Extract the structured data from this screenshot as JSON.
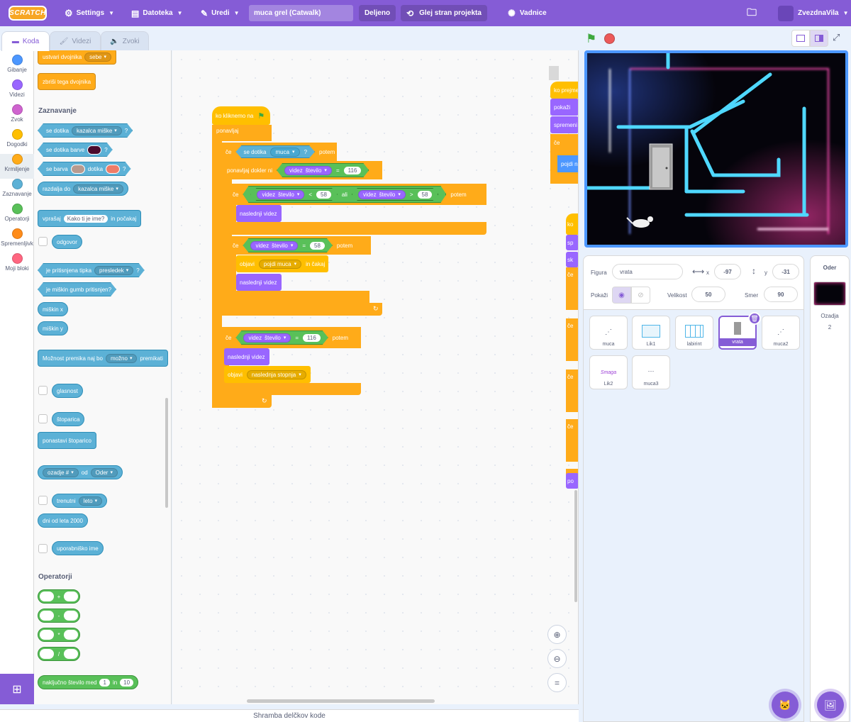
{
  "menu": {
    "logo": "SCRATCH",
    "settings": "Settings",
    "file": "Datoteka",
    "edit": "Uredi",
    "project_title": "muca grel (Catwalk)",
    "share": "Deljeno",
    "see_project": "Glej stran projekta",
    "tutorials": "Vadnice",
    "username": "ZvezdnaVila"
  },
  "tabs": {
    "code": "Koda",
    "costumes": "Videzi",
    "sounds": "Zvoki"
  },
  "categories": [
    {
      "label": "Gibanje",
      "color": "#4c97ff"
    },
    {
      "label": "Videzi",
      "color": "#9966ff"
    },
    {
      "label": "Zvok",
      "color": "#cf63cf"
    },
    {
      "label": "Dogodki",
      "color": "#ffbf00"
    },
    {
      "label": "Krmiljenje",
      "color": "#ffab19"
    },
    {
      "label": "Zaznavanje",
      "color": "#5cb1d6"
    },
    {
      "label": "Operatorji",
      "color": "#59c059"
    },
    {
      "label": "Spremenljivk",
      "color": "#ff8c1a"
    },
    {
      "label": "Moji bloki",
      "color": "#ff6680"
    }
  ],
  "palette": {
    "clone_create": "ustvari dvojnika",
    "clone_target": "sebe",
    "clone_delete": "zbriši tega dvojnika",
    "sensing_header": "Zaznavanje",
    "touching": "se dotika",
    "touching_target": "kazalca miške",
    "q": "?",
    "touching_color": "se dotika barve",
    "color_touch_a": "se barva",
    "color_touch_b": "dotika",
    "distance": "razdalja do",
    "distance_target": "kazalca miške",
    "ask": "vprašaj",
    "ask_value": "Kako ti je ime?",
    "ask_wait": "in počakaj",
    "answer": "odgovor",
    "key_pressed": "je pritisnjena tipka",
    "key_value": "presledek",
    "mouse_down": "je miškin gumb pritisnjen?",
    "mouse_x": "miškin x",
    "mouse_y": "miškin y",
    "drag_mode": "Možnost premika naj bo",
    "drag_value": "možno",
    "drag_tail": "premikati",
    "loudness": "glasnost",
    "timer": "štoparica",
    "reset_timer": "ponastavi štoparico",
    "backdrop_of": "ozadje #",
    "backdrop_of_b": "od",
    "backdrop_target": "Oder",
    "current": "trenutni",
    "current_value": "leto",
    "days_since": "dni od leta 2000",
    "username": "uporabniško ime",
    "operators_header": "Operatorji",
    "op_add": "+",
    "op_sub": "-",
    "op_mul": "*",
    "op_div": "/",
    "random": "naključno število med",
    "random_from": "1",
    "random_and": "in",
    "random_to": "10"
  },
  "script": {
    "hat": "ko kliknemo na",
    "forever": "ponavljaj",
    "if1": "če",
    "touching": "se dotika",
    "touching_target": "muca",
    "q": "?",
    "then": "potem",
    "repeat_until": "ponavljaj dokler ni",
    "costume": "videz",
    "number": "število",
    "eq": "=",
    "v116": "116",
    "lt": "<",
    "gt": ">",
    "v58": "58",
    "or": "ali",
    "next_costume": "naslednji videz",
    "broadcast": "objavi",
    "broadcast_msg": "pojdi muca",
    "and_wait": "in čakaj",
    "broadcast_msg2": "naslednja stopnja",
    "side": {
      "s1": "ko prejme",
      "s2": "pokaži",
      "s3": "spremeni",
      "s4": "če",
      "s5": "pojdi na",
      "s6": "ko",
      "s7": "sp",
      "s8": "sk",
      "s9": "če",
      "s10": "če",
      "s11": "če",
      "s12": "če",
      "s13": "če",
      "s14": "po"
    }
  },
  "sprite_info": {
    "sprite_label": "Figura",
    "sprite_name": "vrata",
    "x_label": "x",
    "x": "-97",
    "y_label": "y",
    "y": "-31",
    "show_label": "Pokaži",
    "size_label": "Velikost",
    "size": "50",
    "direction_label": "Smer",
    "direction": "90"
  },
  "sprites": [
    {
      "name": "muca"
    },
    {
      "name": "Lik1"
    },
    {
      "name": "labirint"
    },
    {
      "name": "vrata"
    },
    {
      "name": "muca2"
    },
    {
      "name": "Lik2"
    },
    {
      "name": "muca3"
    }
  ],
  "sprite_thumb_text": "Smaga",
  "stage_pane": {
    "title": "Oder",
    "backdrops_label": "Ozadja",
    "backdrops_count": "2"
  },
  "backpack": "Shramba delčkov kode",
  "colors": {
    "menu": "#855cd6",
    "control": "#ffab19",
    "looks": "#9966ff",
    "sensing": "#5cb1d6",
    "operators": "#59c059",
    "events": "#ffbf00",
    "stage_cyan": "#4fd8ff",
    "stage_pink": "#ff3fa8"
  }
}
